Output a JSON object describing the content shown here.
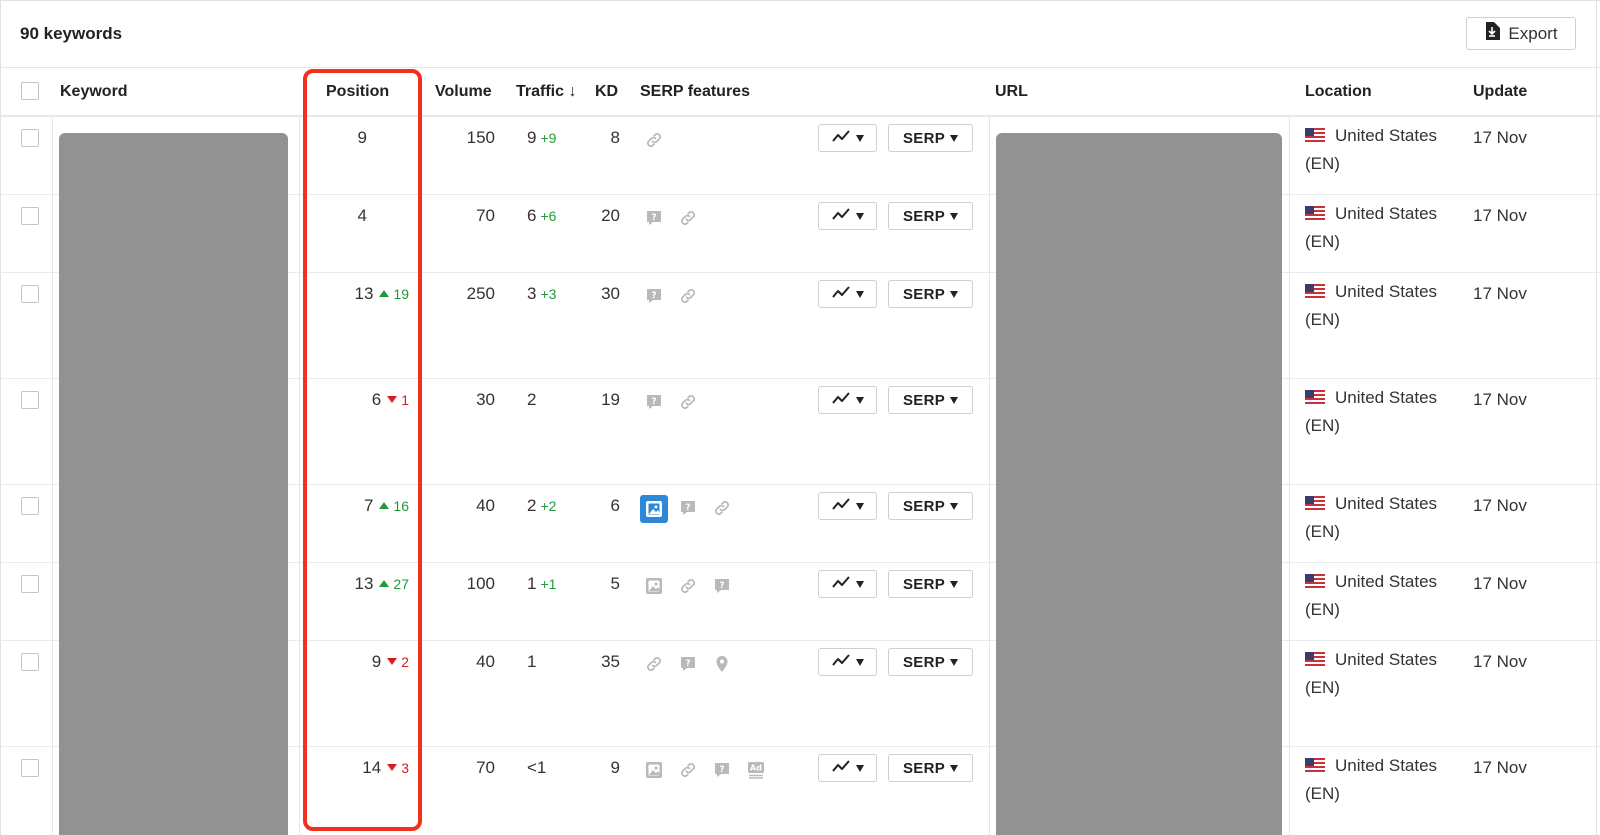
{
  "header": {
    "keyword_count": "90 keywords",
    "export_label": "Export"
  },
  "columns": {
    "keyword": "Keyword",
    "position": "Position",
    "volume": "Volume",
    "traffic": "Traffic ↓",
    "kd": "KD",
    "serp_features": "SERP features",
    "url": "URL",
    "location": "Location",
    "update": "Update"
  },
  "serp_button_label": "SERP",
  "rows": [
    {
      "position": "9",
      "pos_dir": "",
      "pos_delta": "",
      "volume": "150",
      "traffic": "9",
      "traffic_delta": "+9",
      "kd": "8",
      "features": [
        "link-icon"
      ],
      "location": "United States",
      "lang": "(EN)",
      "update": "17 Nov"
    },
    {
      "position": "4",
      "pos_dir": "",
      "pos_delta": "",
      "volume": "70",
      "traffic": "6",
      "traffic_delta": "+6",
      "kd": "20",
      "features": [
        "question-icon",
        "link-icon"
      ],
      "location": "United States",
      "lang": "(EN)",
      "update": "17 Nov"
    },
    {
      "position": "13",
      "pos_dir": "up",
      "pos_delta": "19",
      "volume": "250",
      "traffic": "3",
      "traffic_delta": "+3",
      "kd": "30",
      "features": [
        "question-icon",
        "link-icon"
      ],
      "location": "United States",
      "lang": "(EN)",
      "update": "17 Nov"
    },
    {
      "position": "6",
      "pos_dir": "down",
      "pos_delta": "1",
      "volume": "30",
      "traffic": "2",
      "traffic_delta": "",
      "kd": "19",
      "features": [
        "question-icon",
        "link-icon"
      ],
      "location": "United States",
      "lang": "(EN)",
      "update": "17 Nov"
    },
    {
      "position": "7",
      "pos_dir": "up",
      "pos_delta": "16",
      "volume": "40",
      "traffic": "2",
      "traffic_delta": "+2",
      "kd": "6",
      "features": [
        "image-pack-icon-active",
        "question-icon",
        "link-icon"
      ],
      "location": "United States",
      "lang": "(EN)",
      "update": "17 Nov"
    },
    {
      "position": "13",
      "pos_dir": "up",
      "pos_delta": "27",
      "volume": "100",
      "traffic": "1",
      "traffic_delta": "+1",
      "kd": "5",
      "features": [
        "image-pack-icon",
        "link-icon",
        "question-icon"
      ],
      "location": "United States",
      "lang": "(EN)",
      "update": "17 Nov"
    },
    {
      "position": "9",
      "pos_dir": "down",
      "pos_delta": "2",
      "volume": "40",
      "traffic": "1",
      "traffic_delta": "",
      "kd": "35",
      "features": [
        "link-icon",
        "question-icon",
        "map-pin-icon"
      ],
      "location": "United States",
      "lang": "(EN)",
      "update": "17 Nov"
    },
    {
      "position": "14",
      "pos_dir": "down",
      "pos_delta": "3",
      "volume": "70",
      "traffic": "<1",
      "traffic_delta": "",
      "kd": "9",
      "features": [
        "image-pack-icon",
        "link-icon",
        "question-icon",
        "ad-icon"
      ],
      "location": "United States",
      "lang": "(EN)",
      "update": "17 Nov"
    }
  ],
  "colors": {
    "up": "#1f9a3a",
    "down": "#d31f1f",
    "highlight": "#f0311c",
    "active_feature": "#2d88d9",
    "redaction": "#929292"
  }
}
